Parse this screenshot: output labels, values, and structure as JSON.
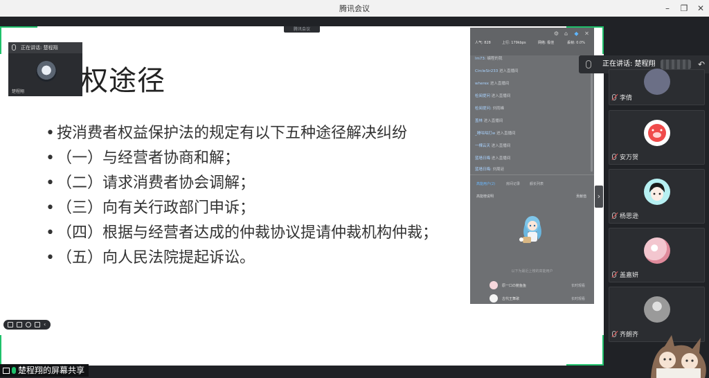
{
  "window": {
    "title": "腾讯会议"
  },
  "share": {
    "tag": "腾讯会议",
    "slide_title": "权途径",
    "bullets": [
      "按消费者权益保护法的规定有以下五种途径解决纠纷",
      "（一）与经营者协商和解；",
      "（二）请求消费者协会调解；",
      "（三）向有关行政部门申诉；",
      "（四）根据与经营者达成的仲裁协议提请仲裁机构仲裁；",
      "（五）向人民法院提起诉讼。"
    ],
    "bullet_glyph": "•",
    "label": "楚程翔的屏幕共享"
  },
  "speaker_thumb": {
    "bar_text": "正在讲话: 楚程翔",
    "name": "楚程翔"
  },
  "live_panel": {
    "stats": {
      "popularity": "人气: 828",
      "upload": "上行: 179kbps",
      "network": "网络: 极佳",
      "loss": "丢帧: 0.0%"
    },
    "messages": [
      {
        "user": "lm73:",
        "text": "编程的我"
      },
      {
        "user": "CircleSir233",
        "text": "进入直播间"
      },
      {
        "user": "wherex",
        "text": "进入直播间"
      },
      {
        "user": "检阅提问",
        "text": "进入直播间"
      },
      {
        "user": "检阅提问:",
        "text": "刘雨峰"
      },
      {
        "user": "盖林",
        "text": "进入直播间"
      },
      {
        "user": "_睡咕咕打w",
        "text": "进入直播间"
      },
      {
        "user": "一棵云天",
        "text": "进入直播间"
      },
      {
        "user": "蓝墙日晦",
        "text": "进入直播间"
      },
      {
        "user": "蓝墙日晦:",
        "text": "刘周廷"
      }
    ],
    "tabs": [
      "高能用户(2)",
      "房间记录",
      "舰长列表"
    ],
    "sub_left": "高能榜说明",
    "sub_right": "贡献值",
    "empty_hint": "以下为最近上榜的高能用户",
    "viewers": [
      {
        "name": "原一口の鲍鱼鱼",
        "time": "长时观看"
      },
      {
        "name": "古代王舞歌",
        "time": "长时观看"
      }
    ]
  },
  "talking_banner": {
    "text": "正在讲话: 楚程翔"
  },
  "participants": [
    {
      "name": "李倩",
      "avatar_color": "#6b6f86"
    },
    {
      "name": "安万贺",
      "avatar_color": "#ffffff"
    },
    {
      "name": "杨思逊",
      "avatar_color": "#b6f0f2"
    },
    {
      "name": "盖嘉妍",
      "avatar_color": "#f3c6cf"
    },
    {
      "name": "齐朗齐",
      "avatar_color": "#9a9a9a"
    }
  ],
  "colors": {
    "accent_green": "#1fc16b",
    "panel": "#6e7073",
    "tile_bg": "#2b2d31"
  }
}
